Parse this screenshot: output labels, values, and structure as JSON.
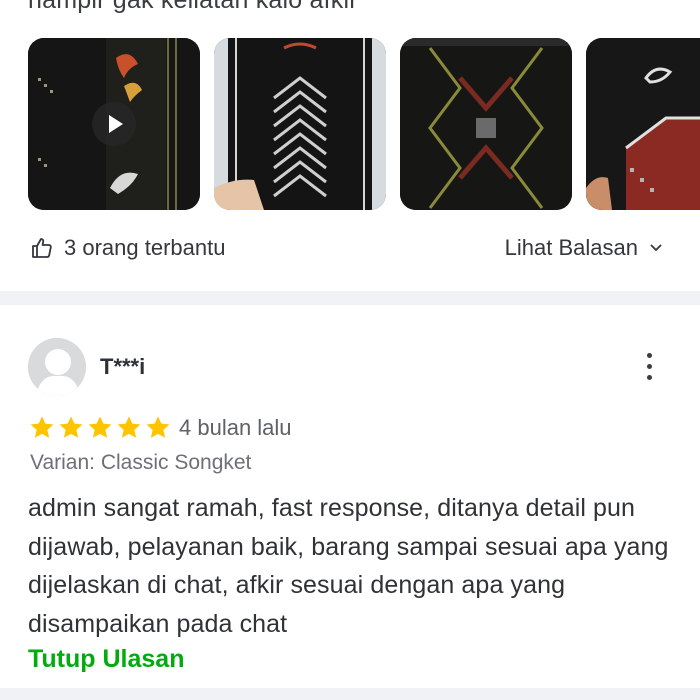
{
  "top_text": "hampir gak keliatan kalo afkir",
  "media": [
    {
      "type": "video",
      "icon": "play-icon"
    },
    {
      "type": "image"
    },
    {
      "type": "image"
    },
    {
      "type": "image"
    }
  ],
  "helpful": {
    "icon": "thumbs-up-icon",
    "label": "3 orang terbantu"
  },
  "see_replies": {
    "label": "Lihat Balasan",
    "icon": "chevron-down-icon"
  },
  "review": {
    "username": "T***i",
    "rating": 5,
    "time": "4 bulan lalu",
    "variant": "Varian: Classic Songket",
    "text": "admin sangat ramah, fast response, ditanya detail pun dijawab, pelayanan baik, barang sampai sesuai apa yang dijelaskan di chat, afkir sesuai dengan apa yang disampaikan pada chat",
    "collapse_label": "Tutup Ulasan"
  },
  "colors": {
    "accent_green": "#03ac0e",
    "star": "#ffc400",
    "divider": "#f1f2f5"
  }
}
